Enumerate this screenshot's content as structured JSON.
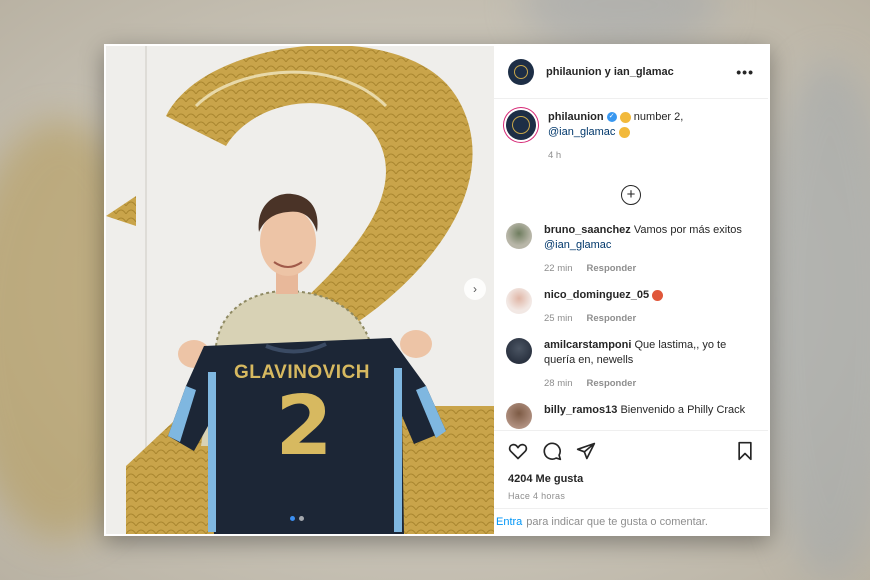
{
  "post": {
    "author_header": "philaunion y ian_glamac",
    "more_label": "•••",
    "caption": {
      "username": "philaunion",
      "verified_mark": "✓",
      "text": "number 2,",
      "mention": "@ian_glamac",
      "time": "4 h"
    },
    "load_more_label": "+",
    "comments": [
      {
        "username": "bruno_saanchez",
        "text": "Vamos por más exitos",
        "mention": "@ian_glamac",
        "time": "22 min",
        "reply": "Responder"
      },
      {
        "username": "nico_dominguez_05",
        "text": "",
        "time": "25 min",
        "reply": "Responder"
      },
      {
        "username": "amilcarstamponi",
        "text": "Que lastima,, yo te quería en, newells",
        "time": "28 min",
        "reply": "Responder"
      },
      {
        "username": "billy_ramos13",
        "text": "Bienvenido a Philly Crack"
      }
    ],
    "likes": "4204 Me gusta",
    "posted_ago": "Hace 4 horas",
    "login_prompt": {
      "link": "Entra",
      "text": "para indicar que te gusta o comentar."
    },
    "photo": {
      "jersey_name": "GLAVINOVICH",
      "jersey_number": "2",
      "carousel_next": "›"
    }
  },
  "icons": [
    "heart-icon",
    "comment-icon",
    "share-icon",
    "bookmark-icon"
  ],
  "colors": {
    "link": "#0095f6",
    "mention": "#00376b",
    "verified": "#3897f0",
    "jersey": "#1c2636",
    "gold": "#c9a44a",
    "sky": "#7fb7e0"
  }
}
